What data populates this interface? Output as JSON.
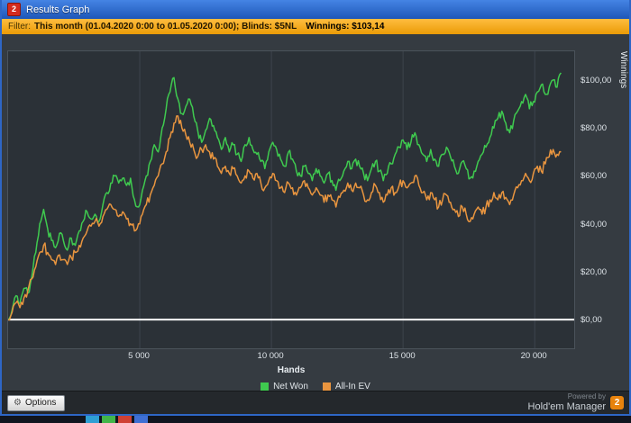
{
  "window": {
    "title": "Results Graph",
    "icon_text": "2"
  },
  "filter_bar": {
    "label": "Filter:",
    "criteria": "This month (01.04.2020 0:00 to 01.05.2020 0:00); Blinds: $5NL",
    "winnings": "Winnings: $103,14"
  },
  "chart_data": {
    "type": "line",
    "xlabel": "Hands",
    "ylabel": "Winnings",
    "xlim": [
      0,
      21500
    ],
    "ylim": [
      -12,
      112
    ],
    "x_ticks": [
      5000,
      10000,
      15000,
      20000
    ],
    "x_tick_labels": [
      "5 000",
      "10 000",
      "15 000",
      "20 000"
    ],
    "y_ticks": [
      0,
      20,
      40,
      60,
      80,
      100
    ],
    "y_tick_labels": [
      "$0,00",
      "$20,00",
      "$40,00",
      "$60,00",
      "$80,00",
      "$100,00"
    ],
    "grid": "vertical-only",
    "zero_line": 0,
    "legend_position": "bottom-center",
    "series": [
      {
        "name": "Net Won",
        "color": "#3fca4f",
        "x_start": 0,
        "x_step": 150,
        "y": [
          0,
          4,
          10,
          7,
          13,
          11,
          18,
          28,
          40,
          46,
          38,
          33,
          30,
          36,
          33,
          29,
          34,
          31,
          37,
          41,
          45,
          42,
          44,
          41,
          48,
          53,
          57,
          60,
          57,
          59,
          56,
          59,
          50,
          47,
          54,
          60,
          66,
          73,
          70,
          80,
          88,
          95,
          101,
          92,
          86,
          89,
          92,
          85,
          79,
          74,
          79,
          84,
          81,
          76,
          71,
          76,
          70,
          73,
          69,
          66,
          73,
          76,
          71,
          69,
          66,
          63,
          70,
          74,
          71,
          67,
          64,
          70,
          67,
          62,
          60,
          64,
          61,
          58,
          63,
          60,
          57,
          61,
          58,
          54,
          58,
          62,
          66,
          63,
          67,
          64,
          61,
          58,
          63,
          66,
          62,
          58,
          61,
          65,
          69,
          72,
          75,
          71,
          74,
          78,
          73,
          69,
          66,
          71,
          67,
          64,
          69,
          72,
          68,
          64,
          61,
          66,
          63,
          59,
          62,
          66,
          69,
          72,
          76,
          80,
          84,
          87,
          82,
          78,
          83,
          87,
          91,
          94,
          88,
          91,
          95,
          98,
          94,
          97,
          100,
          97,
          103
        ]
      },
      {
        "name": "All-In EV",
        "color": "#e9953f",
        "x_start": 0,
        "x_step": 150,
        "y": [
          0,
          3,
          7,
          5,
          9,
          12,
          17,
          22,
          28,
          31,
          28,
          25,
          23,
          27,
          25,
          23,
          26,
          28,
          31,
          34,
          37,
          39,
          41,
          39,
          43,
          46,
          48,
          46,
          43,
          45,
          42,
          40,
          37,
          40,
          44,
          48,
          52,
          56,
          60,
          65,
          70,
          76,
          82,
          85,
          80,
          77,
          74,
          71,
          68,
          71,
          73,
          70,
          67,
          64,
          61,
          64,
          61,
          63,
          60,
          57,
          60,
          62,
          59,
          61,
          57,
          55,
          58,
          61,
          58,
          55,
          53,
          57,
          55,
          52,
          55,
          58,
          55,
          52,
          55,
          52,
          49,
          52,
          50,
          47,
          51,
          54,
          57,
          54,
          57,
          55,
          52,
          50,
          53,
          56,
          53,
          49,
          52,
          55,
          53,
          56,
          58,
          55,
          57,
          60,
          56,
          53,
          50,
          53,
          50,
          47,
          50,
          52,
          49,
          46,
          43,
          47,
          44,
          41,
          44,
          47,
          44,
          47,
          50,
          53,
          50,
          53,
          51,
          48,
          52,
          55,
          58,
          61,
          58,
          61,
          64,
          62,
          65,
          68,
          71,
          69,
          70
        ]
      }
    ]
  },
  "footer": {
    "options_label": "Options",
    "powered_by": "Powered by",
    "brand": "Hold'em Manager",
    "brand_logo_text": "2"
  },
  "taskbar": {
    "item_colors": [
      "#2e9fd4",
      "#41b649",
      "#cf4034",
      "#3f6fd4"
    ]
  }
}
